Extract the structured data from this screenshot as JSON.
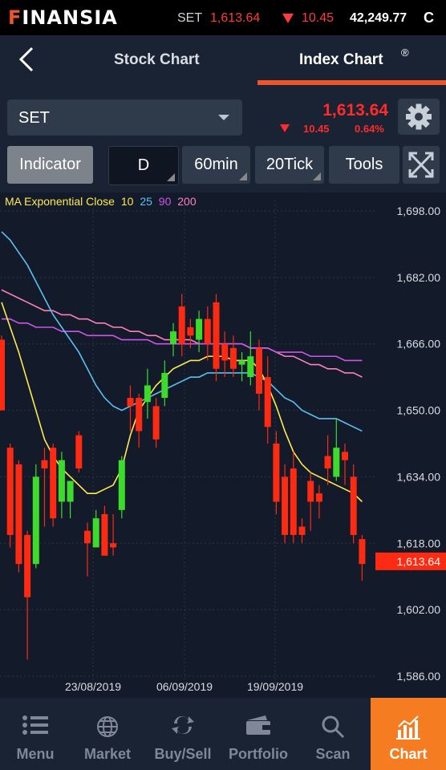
{
  "brand": {
    "name": "FINANSIA",
    "first_letter": "F",
    "rest": "INANSIA",
    "color": "#f0542d"
  },
  "ticker": {
    "symbol": "SET",
    "value": "1,613.64",
    "change": "10.45",
    "volume": "42,249.77",
    "suffix": "C"
  },
  "header": {
    "back_icon": "chevron-left-icon",
    "tabs": [
      {
        "label": "Stock Chart",
        "active": false
      },
      {
        "label": "Index Chart",
        "active": true
      }
    ],
    "active_mark": "®"
  },
  "selector": {
    "value": "SET"
  },
  "quote": {
    "price": "1,613.64",
    "change": "10.45",
    "percent": "0.64%",
    "direction": "down",
    "color": "#ff2a2a"
  },
  "toolbar": {
    "indicator": "Indicator",
    "period_d": "D",
    "period_60": "60min",
    "period_20": "20Tick",
    "tools": "Tools"
  },
  "legend": {
    "title": "MA Exponential Close",
    "periods": [
      "10",
      "25",
      "90",
      "200"
    ],
    "colors": [
      "#ffea4d",
      "#5bc0f0",
      "#cf55e8",
      "#ff7fbf"
    ]
  },
  "chart_data": {
    "type": "candlestick",
    "y_ticks": [
      "1,698.00",
      "1,682.00",
      "1,666.00",
      "1,650.00",
      "1,634.00",
      "1,618.00",
      "1,602.00",
      "1,586.00"
    ],
    "ylim": [
      1586,
      1698
    ],
    "x_ticks": [
      "23/08/2019",
      "06/09/2019",
      "19/09/2019"
    ],
    "last_price_label": "1,613.64",
    "candles": [
      {
        "o": 1667,
        "h": 1668,
        "c": 1650,
        "l": 1650
      },
      {
        "o": 1641,
        "h": 1642,
        "c": 1620,
        "l": 1617
      },
      {
        "o": 1637,
        "h": 1638,
        "c": 1613,
        "l": 1611
      },
      {
        "o": 1620,
        "h": 1621,
        "c": 1605,
        "l": 1590
      },
      {
        "o": 1613,
        "h": 1637,
        "c": 1634,
        "l": 1612
      },
      {
        "o": 1638,
        "h": 1641,
        "c": 1636,
        "l": 1622
      },
      {
        "o": 1641,
        "h": 1642,
        "c": 1624,
        "l": 1622
      },
      {
        "o": 1628,
        "h": 1640,
        "c": 1638,
        "l": 1624
      },
      {
        "o": 1628,
        "h": 1633,
        "c": 1633,
        "l": 1624
      },
      {
        "o": 1644,
        "h": 1645,
        "c": 1636,
        "l": 1635
      },
      {
        "o": 1621,
        "h": 1623,
        "c": 1618,
        "l": 1610
      },
      {
        "o": 1617,
        "h": 1626,
        "c": 1624,
        "l": 1619
      },
      {
        "o": 1625,
        "h": 1627,
        "c": 1615,
        "l": 1617
      },
      {
        "o": 1618,
        "h": 1625,
        "c": 1617,
        "l": 1615
      },
      {
        "o": 1626,
        "h": 1639,
        "c": 1638,
        "l": 1624
      },
      {
        "o": 1653,
        "h": 1656,
        "c": 1651,
        "l": 1645
      },
      {
        "o": 1653,
        "h": 1654,
        "c": 1645,
        "l": 1641
      },
      {
        "o": 1652,
        "h": 1660,
        "c": 1656,
        "l": 1648
      },
      {
        "o": 1651,
        "h": 1653,
        "c": 1643,
        "l": 1641
      },
      {
        "o": 1653,
        "h": 1662,
        "c": 1659,
        "l": 1651
      },
      {
        "o": 1666,
        "h": 1671,
        "c": 1669,
        "l": 1663
      },
      {
        "o": 1675,
        "h": 1678,
        "c": 1666,
        "l": 1663
      },
      {
        "o": 1670,
        "h": 1672,
        "c": 1668,
        "l": 1665
      },
      {
        "o": 1667,
        "h": 1674,
        "c": 1672,
        "l": 1664
      },
      {
        "o": 1672,
        "h": 1675,
        "c": 1666,
        "l": 1662
      },
      {
        "o": 1676,
        "h": 1678,
        "c": 1660,
        "l": 1657
      },
      {
        "o": 1666,
        "h": 1669,
        "c": 1662,
        "l": 1658
      },
      {
        "o": 1665,
        "h": 1668,
        "c": 1660,
        "l": 1658
      },
      {
        "o": 1661,
        "h": 1664,
        "c": 1662,
        "l": 1657
      },
      {
        "o": 1658,
        "h": 1669,
        "c": 1663,
        "l": 1656
      },
      {
        "o": 1665,
        "h": 1667,
        "c": 1654,
        "l": 1650
      },
      {
        "o": 1658,
        "h": 1663,
        "c": 1646,
        "l": 1642
      },
      {
        "o": 1642,
        "h": 1645,
        "c": 1628,
        "l": 1625
      },
      {
        "o": 1634,
        "h": 1637,
        "c": 1620,
        "l": 1618
      },
      {
        "o": 1636,
        "h": 1640,
        "c": 1620,
        "l": 1618
      },
      {
        "o": 1622,
        "h": 1624,
        "c": 1620,
        "l": 1618
      },
      {
        "o": 1633,
        "h": 1635,
        "c": 1628,
        "l": 1621
      },
      {
        "o": 1630,
        "h": 1632,
        "c": 1628,
        "l": 1624
      },
      {
        "o": 1639,
        "h": 1644,
        "c": 1636,
        "l": 1632
      },
      {
        "o": 1634,
        "h": 1648,
        "c": 1641,
        "l": 1633
      },
      {
        "o": 1640,
        "h": 1642,
        "c": 1638,
        "l": 1632
      },
      {
        "o": 1634,
        "h": 1637,
        "c": 1620,
        "l": 1618
      },
      {
        "o": 1619,
        "h": 1620,
        "c": 1613,
        "l": 1609
      }
    ],
    "ma": {
      "10": [
        1676,
        1670,
        1664,
        1657,
        1650,
        1643,
        1639,
        1636,
        1634,
        1632,
        1630,
        1630,
        1631,
        1632,
        1636,
        1644,
        1650,
        1653,
        1656,
        1658,
        1660,
        1661,
        1662,
        1662,
        1663,
        1663,
        1663,
        1662,
        1662,
        1662,
        1660,
        1656,
        1651,
        1645,
        1640,
        1637,
        1635,
        1634,
        1633,
        1632,
        1631,
        1630,
        1628
      ],
      "25": [
        1693,
        1691,
        1688,
        1685,
        1681,
        1677,
        1673,
        1670,
        1667,
        1664,
        1660,
        1656,
        1653,
        1651,
        1650,
        1651,
        1652,
        1653,
        1654,
        1655,
        1656,
        1657,
        1658,
        1658,
        1659,
        1659,
        1659,
        1659,
        1659,
        1659,
        1658,
        1657,
        1655,
        1653,
        1652,
        1650,
        1649,
        1648,
        1648,
        1648,
        1647,
        1646,
        1645
      ],
      "90": [
        1672,
        1672,
        1671,
        1671,
        1670,
        1670,
        1670,
        1669,
        1669,
        1669,
        1668,
        1668,
        1668,
        1668,
        1667,
        1667,
        1667,
        1667,
        1666,
        1666,
        1666,
        1666,
        1666,
        1666,
        1666,
        1666,
        1666,
        1666,
        1666,
        1665,
        1665,
        1665,
        1664,
        1664,
        1664,
        1664,
        1663,
        1663,
        1663,
        1663,
        1662,
        1662,
        1662
      ],
      "200": [
        1679,
        1678,
        1677,
        1676,
        1675,
        1674,
        1674,
        1673,
        1673,
        1672,
        1672,
        1671,
        1671,
        1670,
        1670,
        1669,
        1669,
        1668,
        1668,
        1667,
        1667,
        1667,
        1667,
        1666,
        1666,
        1666,
        1666,
        1666,
        1666,
        1665,
        1665,
        1665,
        1664,
        1663,
        1663,
        1662,
        1661,
        1661,
        1660,
        1660,
        1659,
        1659,
        1658
      ]
    }
  },
  "bottom_nav": [
    {
      "label": "Menu",
      "icon": "menu-list-icon",
      "active": false
    },
    {
      "label": "Market",
      "icon": "globe-icon",
      "active": false
    },
    {
      "label": "Buy/Sell",
      "icon": "swap-arrows-icon",
      "active": false
    },
    {
      "label": "Portfolio",
      "icon": "wallet-icon",
      "active": false
    },
    {
      "label": "Scan",
      "icon": "search-icon",
      "active": false
    },
    {
      "label": "Chart",
      "icon": "bar-chart-icon",
      "active": true
    }
  ]
}
